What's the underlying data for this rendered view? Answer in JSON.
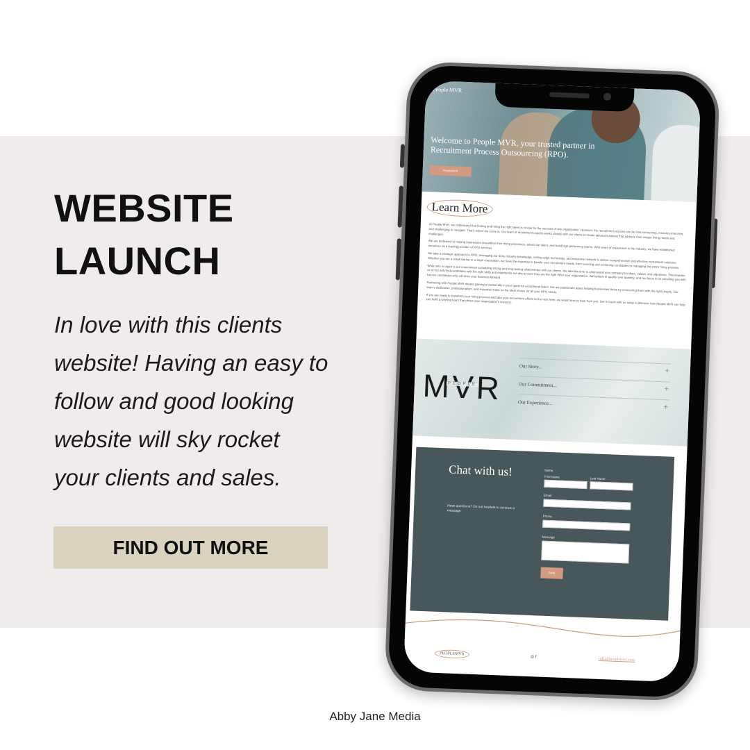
{
  "headline": {
    "line1": "WEBSITE",
    "line2": "LAUNCH"
  },
  "blurb": {
    "lines": [
      "In love with this clients",
      "website! Having an easy to",
      "follow and good looking",
      "website will sky rocket",
      "your clients and sales."
    ]
  },
  "cta": {
    "label": "FIND OUT MORE"
  },
  "credit": "Abby Jane Media",
  "colors": {
    "band": "#f1ecec",
    "cta_bg": "#d9d3c0",
    "accent": "#d59a82",
    "chat_bg": "#48575a"
  },
  "site": {
    "brand": "People MVR",
    "hero_title": "Welcome to People MVR, your trusted partner in Recruitment Process Outsourcing (RPO).",
    "hero_button": "PeopleMVR",
    "learn_more": "Learn More",
    "paragraphs": [
      "At People MVR, we understand that finding and hiring the right talent is crucial for the success of any organization. However, the recruitment process can be time-consuming, resource-intensive, and challenging to navigate. That's where we come in. Our team of recruitment experts works closely with our clients to create tailored solutions that address their unique hiring needs and challenges.",
      "We are dedicated to helping businesses streamline their hiring processes, attract top talent, and build high-performing teams. With years of experience in the industry, we have established ourselves as a leading provider of RPO services.",
      "We take a strategic approach to RPO, leveraging our deep industry knowledge, cutting-edge technology, and extensive network to deliver comprehensive and effective recruitment solutions. Whether you are a small startup or a large corporation, we have the expertise to handle your recruitment needs, from sourcing and screening candidates to managing the entire hiring process.",
      "What sets us apart is our commitment to building strong and long-lasting relationships with our clients. We take the time to understand your company's culture, values, and objectives. This enables us to not only find candidates with the right skills and experience but also ensure they are the right fit for your organization. We believe in quality over quantity, and our focus is on providing you with top-tier candidates who will drive your business forward.",
      "Partnering with People MVR means gaining a trusted ally in your quest for exceptional talent. We are passionate about helping businesses thrive by connecting them with the right people. Our team's dedication, professionalism, and expertise make us the ideal choice for all your RPO needs.",
      "If you are ready to transform your hiring process and take your recruitment efforts to the next level, we would love to hear from you. Get in touch with us today to discover how People MVR can help you build a winning team that drives your organization's success."
    ],
    "mvr_logo": "MVR",
    "mvr_people": "PEOPLE",
    "accordion": [
      "Our Story...",
      "Our Commitment...",
      "Our Experience..."
    ],
    "chat": {
      "title": "Chat with us!",
      "subtitle": "Have questions? Do not hesitate to send us a message.",
      "name_label": "Name",
      "first_name_label": "First Name",
      "last_name_label": "Last Name",
      "email_label": "Email",
      "phone_label": "Phone",
      "message_label": "Message",
      "send_label": "Send"
    },
    "footer": {
      "logo": "PEOPLEMVR",
      "social": "◎ f",
      "email": "info@peoplemvr.com"
    }
  }
}
